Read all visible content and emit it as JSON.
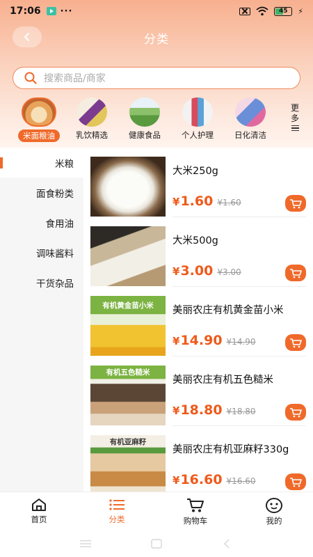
{
  "status_bar": {
    "time": "17:06",
    "dots": "···",
    "battery": "45",
    "battery_level": 0.45
  },
  "header": {
    "title": "分类",
    "back_icon": "chevron-left-icon"
  },
  "search": {
    "placeholder": "搜索商品/商家"
  },
  "categories": [
    {
      "label": "米面粮油",
      "active": true
    },
    {
      "label": "乳饮精选",
      "active": false
    },
    {
      "label": "健康食品",
      "active": false
    },
    {
      "label": "个人护理",
      "active": false
    },
    {
      "label": "日化清洁",
      "active": false
    }
  ],
  "more": {
    "line1": "更",
    "line2": "多"
  },
  "subcategories": [
    {
      "label": "米粮",
      "active": true
    },
    {
      "label": "面食粉类",
      "active": false
    },
    {
      "label": "食用油",
      "active": false
    },
    {
      "label": "调味酱料",
      "active": false
    },
    {
      "label": "干货杂品",
      "active": false
    }
  ],
  "currency": "¥",
  "products": [
    {
      "name": "大米250g",
      "price": "1.60",
      "old_price": "¥1.60"
    },
    {
      "name": "大米500g",
      "price": "3.00",
      "old_price": "¥3.00"
    },
    {
      "name": "美丽农庄有机黄金苗小米",
      "price": "14.90",
      "old_price": "¥14.90",
      "img_text": "有机黄金苗小米"
    },
    {
      "name": "美丽农庄有机五色糙米",
      "price": "18.80",
      "old_price": "¥18.80",
      "img_text": "有机五色糙米"
    },
    {
      "name": "美丽农庄有机亚麻籽330g",
      "price": "16.60",
      "old_price": "¥16.60",
      "img_text": "有机亚麻籽"
    }
  ],
  "tabs": [
    {
      "label": "首页",
      "icon": "home-icon",
      "active": false
    },
    {
      "label": "分类",
      "icon": "list-icon",
      "active": true
    },
    {
      "label": "购物车",
      "icon": "cart-icon",
      "active": false
    },
    {
      "label": "我的",
      "icon": "profile-face-icon",
      "active": false
    }
  ],
  "colors": {
    "accent": "#ef6a2a",
    "price": "#ef5a1a",
    "header_gradient_top": "#f7b08f"
  }
}
